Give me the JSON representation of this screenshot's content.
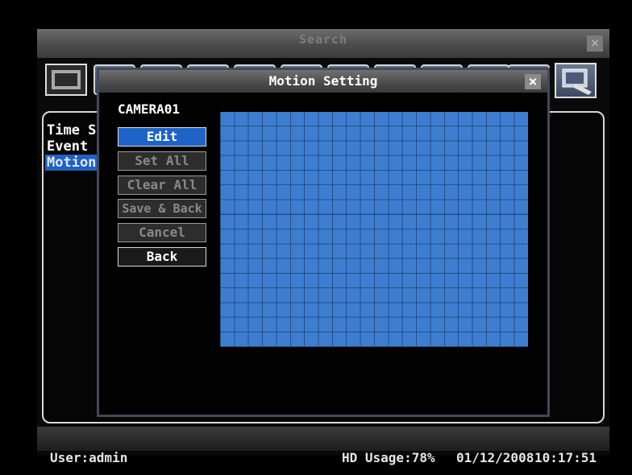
{
  "search_window": {
    "title": "Search",
    "close_glyph": "×"
  },
  "sidebar": {
    "items": [
      {
        "label": "Time Se"
      },
      {
        "label": "Event S"
      },
      {
        "label": "Motion"
      }
    ]
  },
  "dialog": {
    "title": "Motion Setting",
    "close_glyph": "×",
    "camera": "CAMERA01",
    "buttons": [
      {
        "label": "Edit"
      },
      {
        "label": "Set All"
      },
      {
        "label": "Clear All"
      },
      {
        "label": "Save & Back"
      },
      {
        "label": "Cancel"
      },
      {
        "label": "Back"
      }
    ],
    "grid": {
      "columns": 22,
      "rows": 16,
      "color": "#3d7ed0"
    }
  },
  "status_bar": {
    "user": "User:admin",
    "hd_usage": "HD Usage:78%",
    "date": "01/12/2008",
    "time": "10:17:51"
  },
  "colors": {
    "accent": "#1e64c8",
    "grid": "#3d7ed0"
  }
}
